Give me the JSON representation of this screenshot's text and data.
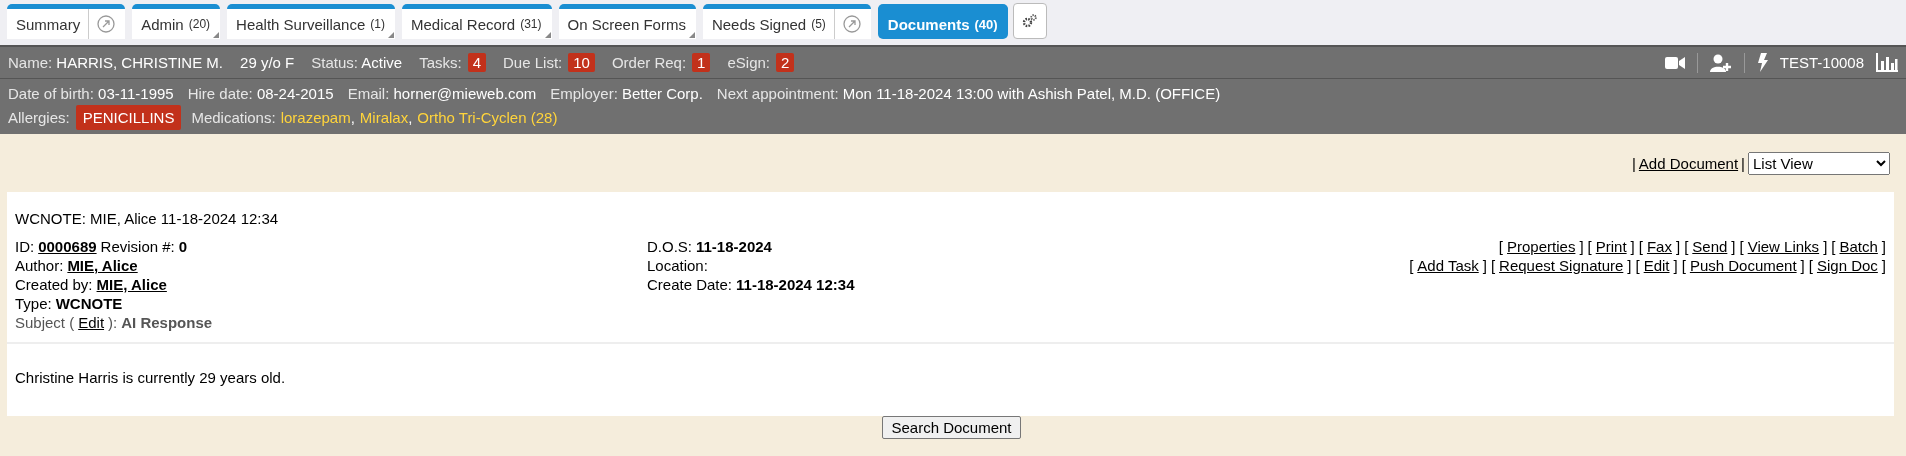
{
  "tabs": [
    {
      "label": "Summary",
      "popout": true,
      "corner": false,
      "selected": false
    },
    {
      "label": "Admin",
      "count": "(20)",
      "popout": false,
      "corner": true,
      "selected": false
    },
    {
      "label": "Health Surveillance",
      "count": "(1)",
      "popout": false,
      "corner": true,
      "selected": false
    },
    {
      "label": "Medical Record",
      "count": "(31)",
      "popout": false,
      "corner": true,
      "selected": false
    },
    {
      "label": "On Screen Forms",
      "popout": false,
      "corner": true,
      "selected": false
    },
    {
      "label": "Needs Signed",
      "count": "(5)",
      "popout": true,
      "corner": false,
      "selected": false
    },
    {
      "label": "Documents",
      "count": "(40)",
      "popout": false,
      "corner": false,
      "selected": true
    }
  ],
  "patient_bar": {
    "items": [
      {
        "kind": "field",
        "label": "Name:",
        "value": "HARRIS, CHRISTINE M."
      },
      {
        "kind": "plain",
        "value": "29 y/o F"
      },
      {
        "kind": "field",
        "label": "Status:",
        "value": "Active"
      },
      {
        "kind": "badge",
        "label": "Tasks:",
        "value": "4"
      },
      {
        "kind": "badge",
        "label": "Due List:",
        "value": "10"
      },
      {
        "kind": "badge",
        "label": "Order Req:",
        "value": "1"
      },
      {
        "kind": "badge",
        "label": "eSign:",
        "value": "2"
      }
    ],
    "patient_id": "TEST-10008"
  },
  "details": {
    "items": [
      {
        "label": "Date of birth:",
        "value": "03-11-1995"
      },
      {
        "label": "Hire date:",
        "value": "08-24-2015"
      },
      {
        "label": "Email:",
        "value": "horner@mieweb.com"
      },
      {
        "label": "Employer:",
        "value": "Better Corp."
      },
      {
        "label": "Next appointment:",
        "value": "Mon 11-18-2024 13:00 with Ashish Patel, M.D. (OFFICE)"
      }
    ],
    "allergies_label": "Allergies:",
    "allergies": [
      "PENICILLINS"
    ],
    "medications_label": "Medications:",
    "medications": [
      "lorazepam",
      "Miralax",
      "Ortho Tri-Cyclen (28)"
    ],
    "medications_separator": ","
  },
  "toolbar": {
    "separator": "|",
    "add_document": "Add Document",
    "view": "List View"
  },
  "document": {
    "title": "WCNOTE: MIE, Alice 11-18-2024 12:34",
    "left": [
      {
        "muted": false,
        "parts": [
          {
            "kind": "label",
            "text": "ID:"
          },
          {
            "kind": "valuelink",
            "text": "0000689"
          },
          {
            "kind": "label",
            "text": "Revision #:"
          },
          {
            "kind": "value",
            "text": "0"
          }
        ]
      },
      {
        "muted": false,
        "parts": [
          {
            "kind": "label",
            "text": "Author:"
          },
          {
            "kind": "valuelink",
            "text": "MIE, Alice"
          }
        ]
      },
      {
        "muted": false,
        "parts": [
          {
            "kind": "label",
            "text": "Created by:"
          },
          {
            "kind": "valuelink",
            "text": "MIE, Alice"
          }
        ]
      },
      {
        "muted": false,
        "parts": [
          {
            "kind": "label",
            "text": "Type:"
          },
          {
            "kind": "value",
            "text": "WCNOTE"
          }
        ]
      },
      {
        "muted": true,
        "parts": [
          {
            "kind": "label",
            "text": "Subject ("
          },
          {
            "kind": "link",
            "text": "Edit"
          },
          {
            "kind": "label",
            "text": "):"
          },
          {
            "kind": "value",
            "text": "AI Response"
          }
        ]
      }
    ],
    "middle": [
      {
        "muted": false,
        "parts": [
          {
            "kind": "label",
            "text": "D.O.S:"
          },
          {
            "kind": "value",
            "text": "11-18-2024"
          }
        ]
      },
      {
        "muted": false,
        "parts": [
          {
            "kind": "label",
            "text": "Location:"
          }
        ]
      },
      {
        "muted": false,
        "parts": [
          {
            "kind": "label",
            "text": "Create Date:"
          },
          {
            "kind": "value",
            "text": "11-18-2024 12:34"
          }
        ]
      }
    ],
    "bracket_open": "[",
    "bracket_close": "]",
    "actions": [
      [
        "Properties",
        "Print",
        "Fax",
        "Send",
        "View Links",
        "Batch"
      ],
      [
        "Add Task",
        "Request Signature",
        "Edit",
        "Push Document",
        "Sign Doc"
      ]
    ],
    "body": "Christine Harris is currently 29 years old."
  },
  "search_button": "Search Document"
}
